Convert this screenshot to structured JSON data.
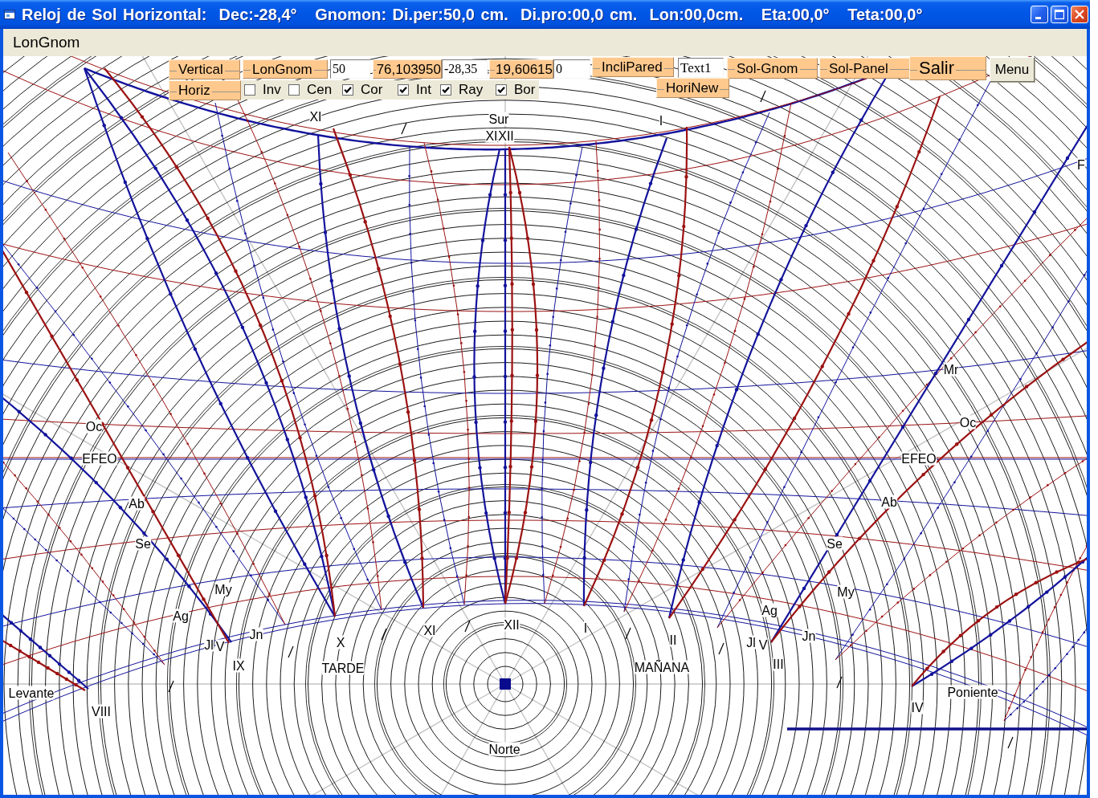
{
  "window": {
    "title": "Reloj de Sol Horizontal:  Dec:-28,4°   Gnomon: Di.per:50,0 cm.  Di.pro:00,0 cm.  Lon:00,0cm.   Eta:00,0°   Teta:00,0°"
  },
  "menu_bar": [
    "LonGnom"
  ],
  "toolbar": {
    "row_1": [
      {
        "kind": "button",
        "label": "Vertical"
      },
      {
        "kind": "button",
        "label": "LonGnom"
      },
      {
        "kind": "field",
        "value": "50"
      },
      {
        "kind": "readout",
        "text": "76,103950"
      },
      {
        "kind": "field",
        "value": "-28,35"
      },
      {
        "kind": "readout",
        "text": "19,60615"
      },
      {
        "kind": "field",
        "value": "0"
      },
      {
        "kind": "button",
        "label": "IncliPared"
      },
      {
        "kind": "field",
        "value": "Text1"
      },
      {
        "kind": "button",
        "label": "Sol-Gnom"
      },
      {
        "kind": "button",
        "label": "Sol-Panel"
      },
      {
        "kind": "button",
        "label": "Salir"
      },
      {
        "kind": "plain_button",
        "label": "Menu"
      }
    ],
    "row_2": [
      {
        "kind": "button",
        "label": "Horiz"
      },
      {
        "kind": "options",
        "options": [
          {
            "label": "Inv",
            "checked": false
          },
          {
            "label": "Cen",
            "checked": false
          },
          {
            "label": "Cor",
            "checked": true
          },
          {
            "label": "Int",
            "checked": true
          },
          {
            "label": "Ray",
            "checked": true
          },
          {
            "label": "Bor",
            "checked": true
          }
        ]
      },
      {
        "kind": "button",
        "label": "HoriNew"
      }
    ]
  },
  "dial": {
    "hour_marks": [
      "XI",
      "XI",
      "XII",
      "I",
      "VIII",
      "V",
      "IX",
      "X",
      "XI",
      "XII",
      "I",
      "II",
      "V",
      "III",
      "IV"
    ],
    "month_marks": [
      "F",
      "Mr",
      "Oc",
      "Oc",
      "EFEO",
      "EFEO",
      "Ab",
      "Ab",
      "Se",
      "Se",
      "My",
      "My",
      "Ag",
      "Ag",
      "Jn",
      "Jn",
      "Jl",
      "Jl"
    ],
    "cardinal_points": [
      "Sur",
      "Levante",
      "Poniente",
      "Norte"
    ],
    "period_labels": [
      "TARDE",
      "MAÑANA"
    ]
  }
}
